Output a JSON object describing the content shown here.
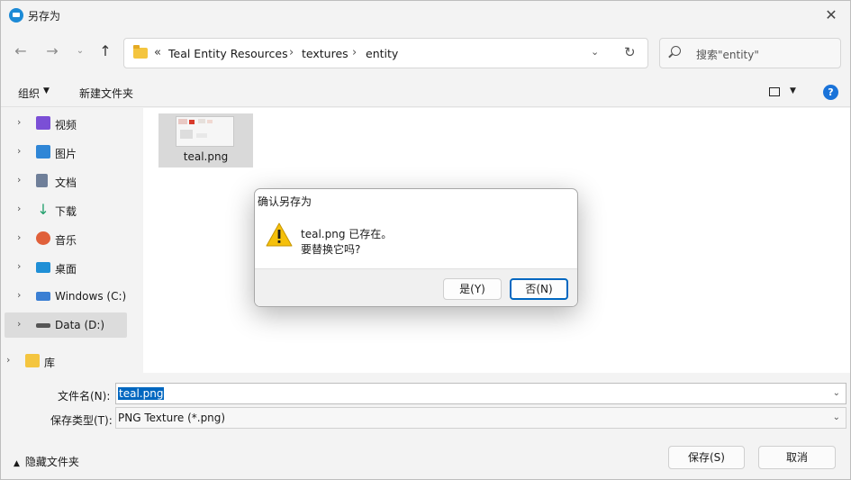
{
  "window": {
    "title": "另存为"
  },
  "navigation": {
    "back_icon": "arrow-left-icon",
    "forward_icon": "arrow-right-icon",
    "recent_icon": "chevron-down-icon",
    "up_icon": "arrow-up-icon",
    "address": {
      "overflow": "«",
      "crumbs": [
        "Teal Entity Resources",
        "textures",
        "entity"
      ],
      "separator": "›"
    },
    "search_placeholder": "搜索\"entity\""
  },
  "toolbar": {
    "organize": "组织",
    "new_folder": "新建文件夹",
    "help": "?"
  },
  "sidebar": {
    "items": [
      {
        "label": "视频",
        "icon": "video-icon",
        "color": "#7b4fd6"
      },
      {
        "label": "图片",
        "icon": "picture-icon",
        "color": "#2f86d6"
      },
      {
        "label": "文档",
        "icon": "document-icon",
        "color": "#6f7f99"
      },
      {
        "label": "下载",
        "icon": "download-icon",
        "color": "#1f9e6a"
      },
      {
        "label": "音乐",
        "icon": "music-icon",
        "color": "#e0603a"
      },
      {
        "label": "桌面",
        "icon": "desktop-icon",
        "color": "#1f8fd6"
      },
      {
        "label": "Windows (C:)",
        "icon": "windows-drive-icon",
        "color": "#3b7fd3"
      },
      {
        "label": "Data (D:)",
        "icon": "drive-icon",
        "color": "#555555"
      },
      {
        "label": "库",
        "icon": "library-folder-icon",
        "color": "#f4c53f"
      }
    ]
  },
  "files": [
    {
      "name": "teal.png"
    }
  ],
  "bottom": {
    "filename_label": "文件名(N):",
    "filename_value": "teal.png",
    "filetype_label": "保存类型(T):",
    "filetype_value": "PNG Texture (*.png)",
    "hide_folders": "隐藏文件夹",
    "save": "保存(S)",
    "cancel": "取消"
  },
  "confirm_dialog": {
    "title": "确认另存为",
    "message_line1": "teal.png 已存在。",
    "message_line2": "要替换它吗?",
    "yes": "是(Y)",
    "no": "否(N)"
  }
}
